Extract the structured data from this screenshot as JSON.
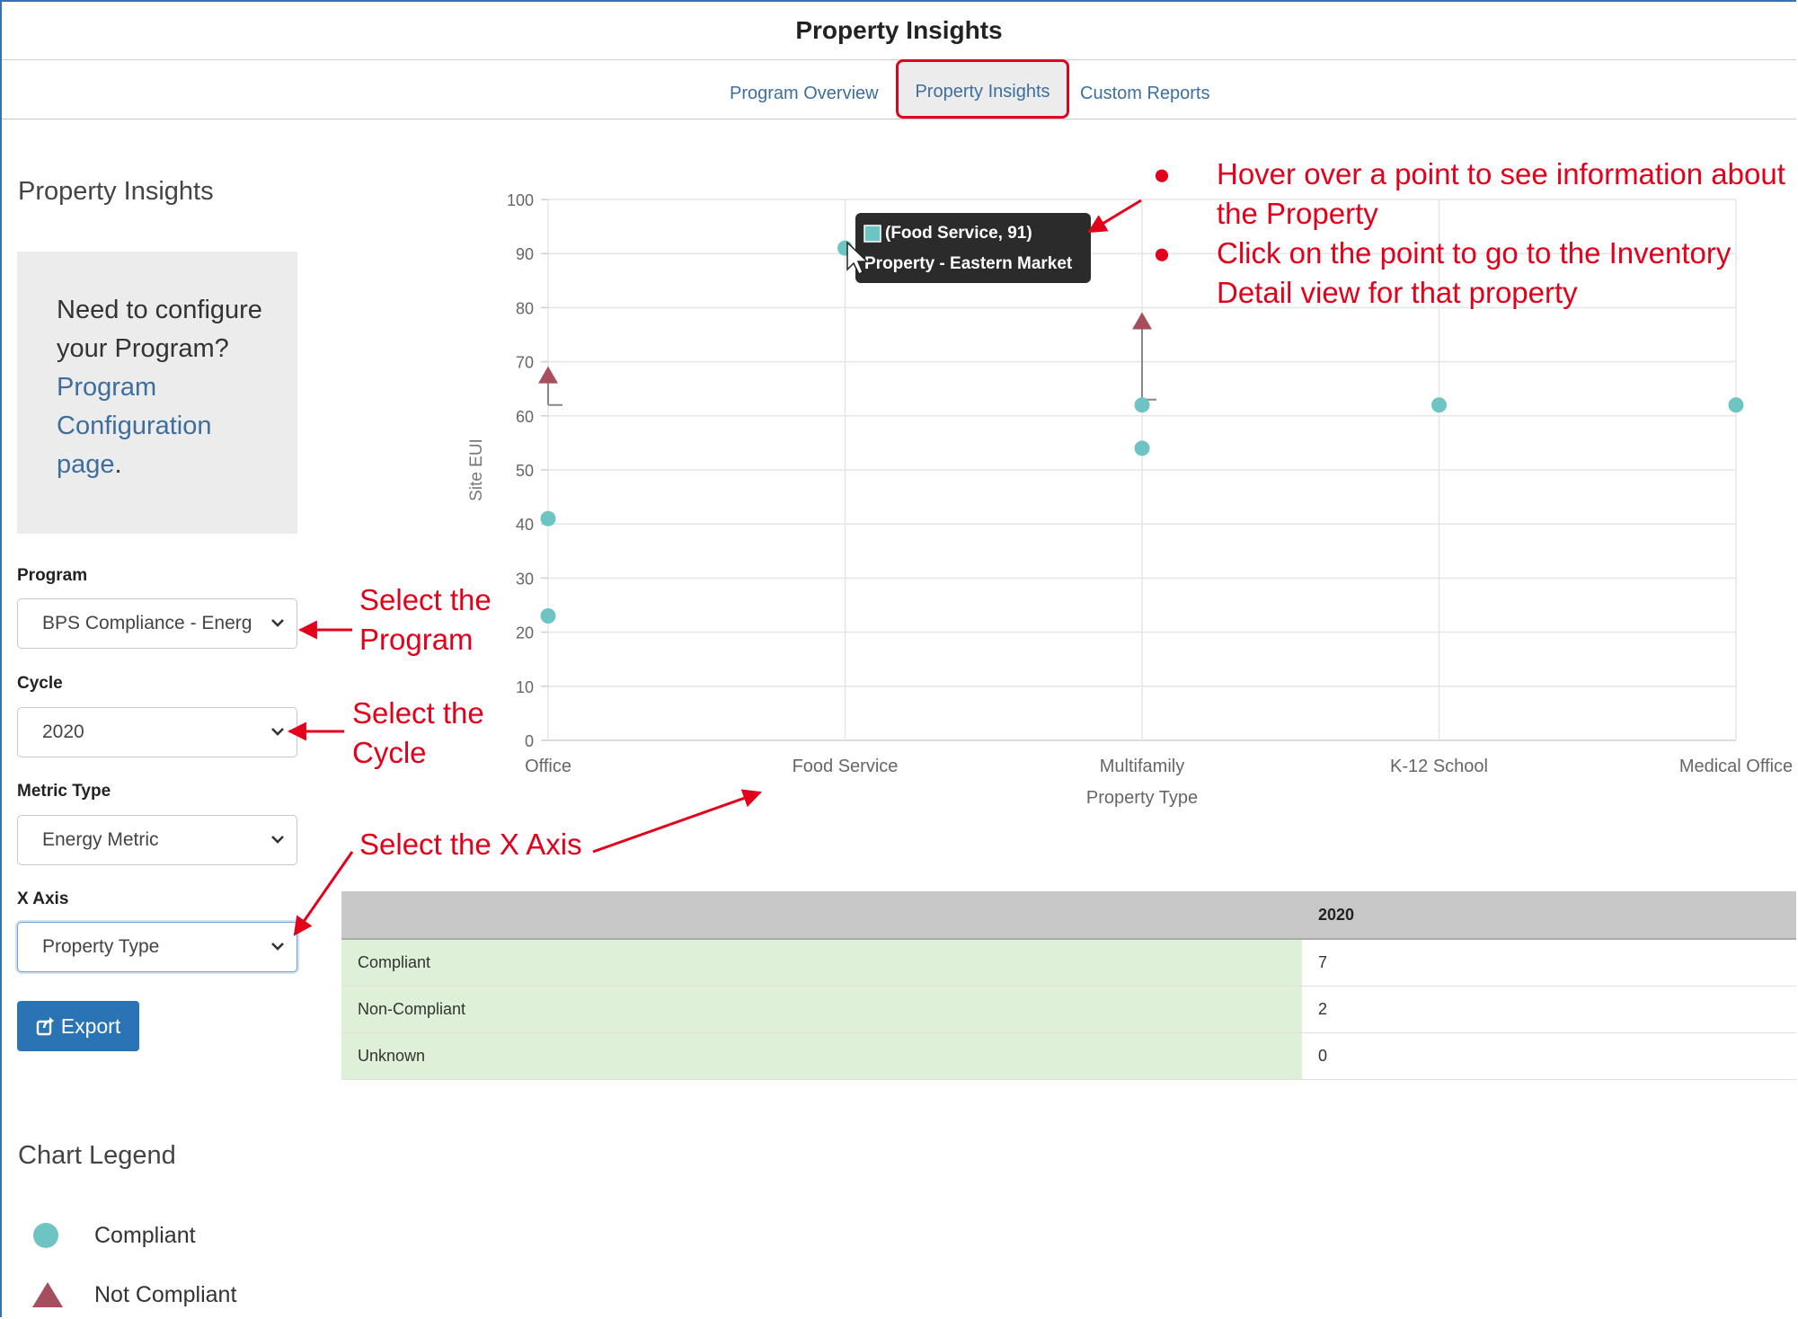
{
  "header": {
    "title": "Property Insights"
  },
  "tabs": [
    {
      "label": "Program Overview",
      "active": false
    },
    {
      "label": "Property Insights",
      "active": true
    },
    {
      "label": "Custom Reports",
      "active": false
    }
  ],
  "sidebar": {
    "title": "Property Insights",
    "config_text": "Need to configure your Program?",
    "config_link": "Program Configuration page",
    "config_suffix": ".",
    "program_label": "Program",
    "program_value": "BPS Compliance - Energ",
    "cycle_label": "Cycle",
    "cycle_value": "2020",
    "metric_label": "Metric Type",
    "metric_value": "Energy Metric",
    "xaxis_label": "X Axis",
    "xaxis_value": "Property Type",
    "export_label": "Export"
  },
  "legend": {
    "title": "Chart Legend",
    "items": [
      {
        "label": "Compliant",
        "color": "#6ec4c2",
        "shape": "circle"
      },
      {
        "label": "Not Compliant",
        "color": "#a64e5e",
        "shape": "triangle"
      }
    ]
  },
  "tooltip": {
    "line1": "(Food Service, 91)",
    "line2": "Property - Eastern Market",
    "color": "#6ec4c2"
  },
  "annotations": {
    "hover_1": "Hover over a point to see information about the Property",
    "hover_2": "Click on the point to go to the Inventory Detail view for that property",
    "select_program": "Select the Program",
    "select_cycle": "Select the Cycle",
    "select_xaxis": "Select the X Axis",
    "bullet": "●"
  },
  "summary_table": {
    "column": "2020",
    "rows": [
      {
        "label": "Compliant",
        "value": "7"
      },
      {
        "label": "Non-Compliant",
        "value": "2"
      },
      {
        "label": "Unknown",
        "value": "0"
      }
    ]
  },
  "chart_data": {
    "type": "scatter",
    "xlabel": "Property Type",
    "ylabel": "Site EUI",
    "categories": [
      "Office",
      "Food Service",
      "Multifamily",
      "K-12 School",
      "Medical Office"
    ],
    "ylim": [
      0,
      100
    ],
    "yticks": [
      "0",
      "10",
      "20",
      "30",
      "40",
      "50",
      "60",
      "70",
      "80",
      "90",
      "100"
    ],
    "grid": true,
    "series": [
      {
        "name": "Compliant",
        "color": "#6ec4c2",
        "points": [
          {
            "x": "Office",
            "y": 41
          },
          {
            "x": "Office",
            "y": 23
          },
          {
            "x": "Food Service",
            "y": 91
          },
          {
            "x": "Multifamily",
            "y": 62
          },
          {
            "x": "Multifamily",
            "y": 54
          },
          {
            "x": "K-12 School",
            "y": 62
          },
          {
            "x": "Medical Office",
            "y": 62
          }
        ]
      },
      {
        "name": "Not Compliant",
        "color": "#a64e5e",
        "points": [
          {
            "x": "Office",
            "y": 67,
            "target": 62
          },
          {
            "x": "Multifamily",
            "y": 77,
            "target": 63
          }
        ]
      }
    ]
  }
}
